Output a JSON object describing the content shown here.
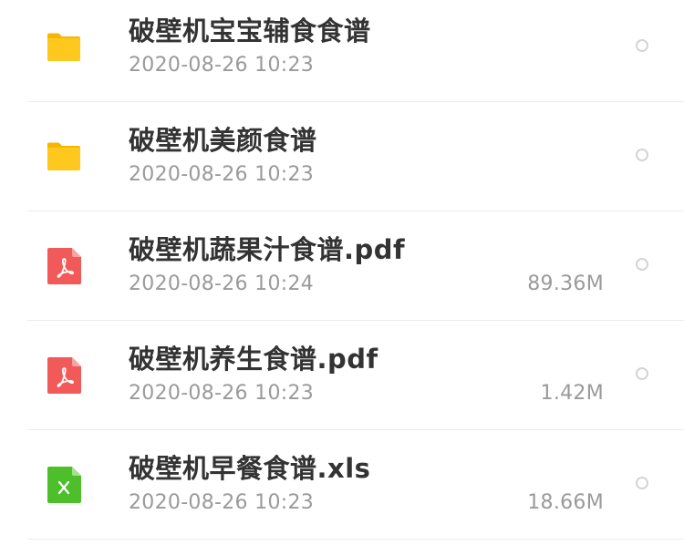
{
  "files": [
    {
      "name": "破壁机宝宝辅食食谱",
      "date": "2020-08-26 10:23",
      "size": "",
      "icon": "folder-icon",
      "icon_color": "#FFC81E"
    },
    {
      "name": "破壁机美颜食谱",
      "date": "2020-08-26 10:23",
      "size": "",
      "icon": "folder-icon",
      "icon_color": "#FFC81E"
    },
    {
      "name": "破壁机蔬果汁食谱.pdf",
      "date": "2020-08-26 10:24",
      "size": "89.36M",
      "icon": "pdf-file-icon",
      "icon_color": "#F25A5A"
    },
    {
      "name": "破壁机养生食谱.pdf",
      "date": "2020-08-26 10:23",
      "size": "1.42M",
      "icon": "pdf-file-icon",
      "icon_color": "#F25A5A"
    },
    {
      "name": "破壁机早餐食谱.xls",
      "date": "2020-08-26 10:23",
      "size": "18.66M",
      "icon": "excel-file-icon",
      "icon_color": "#4CBF2A"
    }
  ]
}
